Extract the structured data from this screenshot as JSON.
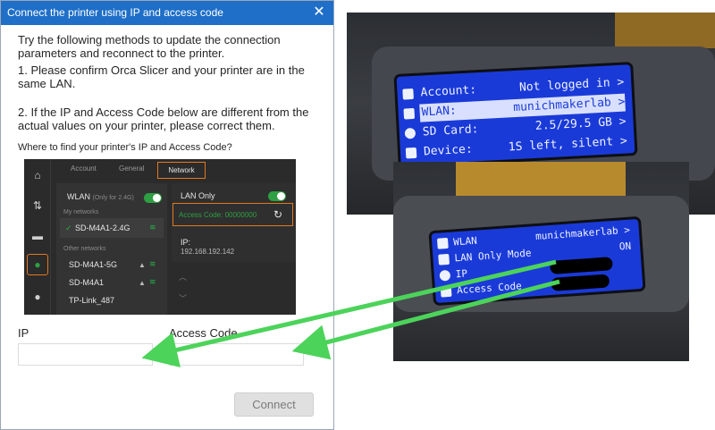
{
  "dialog": {
    "title": "Connect the printer using IP and access code",
    "intro": "Try the following methods to update the connection parameters and reconnect to the printer.",
    "step1": "1. Please confirm Orca Slicer and your printer are in the same LAN.",
    "step2": "2. If the IP and Access Code below are different from the actual values on your printer, please correct them.",
    "help_text": "Where to find your printer's IP and Access Code?",
    "ip_label": "IP",
    "ip_value": "",
    "access_code_label": "Access Code",
    "access_code_value": "",
    "connect_label": "Connect"
  },
  "app_screenshot": {
    "tabs": [
      "Account",
      "General",
      "Network"
    ],
    "active_tab": "Network",
    "wlan_label": "WLAN",
    "wlan_note": "(Only for 2.4G)",
    "my_networks_label": "My networks",
    "my_network": "SD-M4A1-2.4G",
    "other_networks_label": "Other networks",
    "other_networks": [
      "SD-M4A1-5G",
      "SD-M4A1",
      "TP-Link_487"
    ],
    "lan_only_label": "LAN Only",
    "access_code_label": "Access Code:",
    "access_code_value": "00000000",
    "ip_label": "IP:",
    "ip_value": "192.168.192.142",
    "colors": {
      "accent": "#e07a1f",
      "green": "#2ea043"
    }
  },
  "photo_top_lcd": {
    "rows": [
      {
        "label": "Account:",
        "value": "Not logged in >"
      },
      {
        "label": "WLAN:",
        "value": "munichmakerlab >"
      },
      {
        "label": "SD Card:",
        "value": "2.5/29.5 GB >"
      },
      {
        "label": "Device:",
        "value": "1S left, silent >"
      }
    ]
  },
  "photo_bottom_lcd": {
    "rows": [
      {
        "label": "WLAN",
        "value": "munichmakerlab >"
      },
      {
        "label": "LAN Only Mode",
        "value": "ON"
      },
      {
        "label": "IP",
        "value": ""
      },
      {
        "label": "Access Code",
        "value": ""
      }
    ]
  },
  "colors": {
    "title_bar": "#1f6fc8",
    "lcd": "#1a3ad8",
    "arrow": "#4cd35a"
  }
}
